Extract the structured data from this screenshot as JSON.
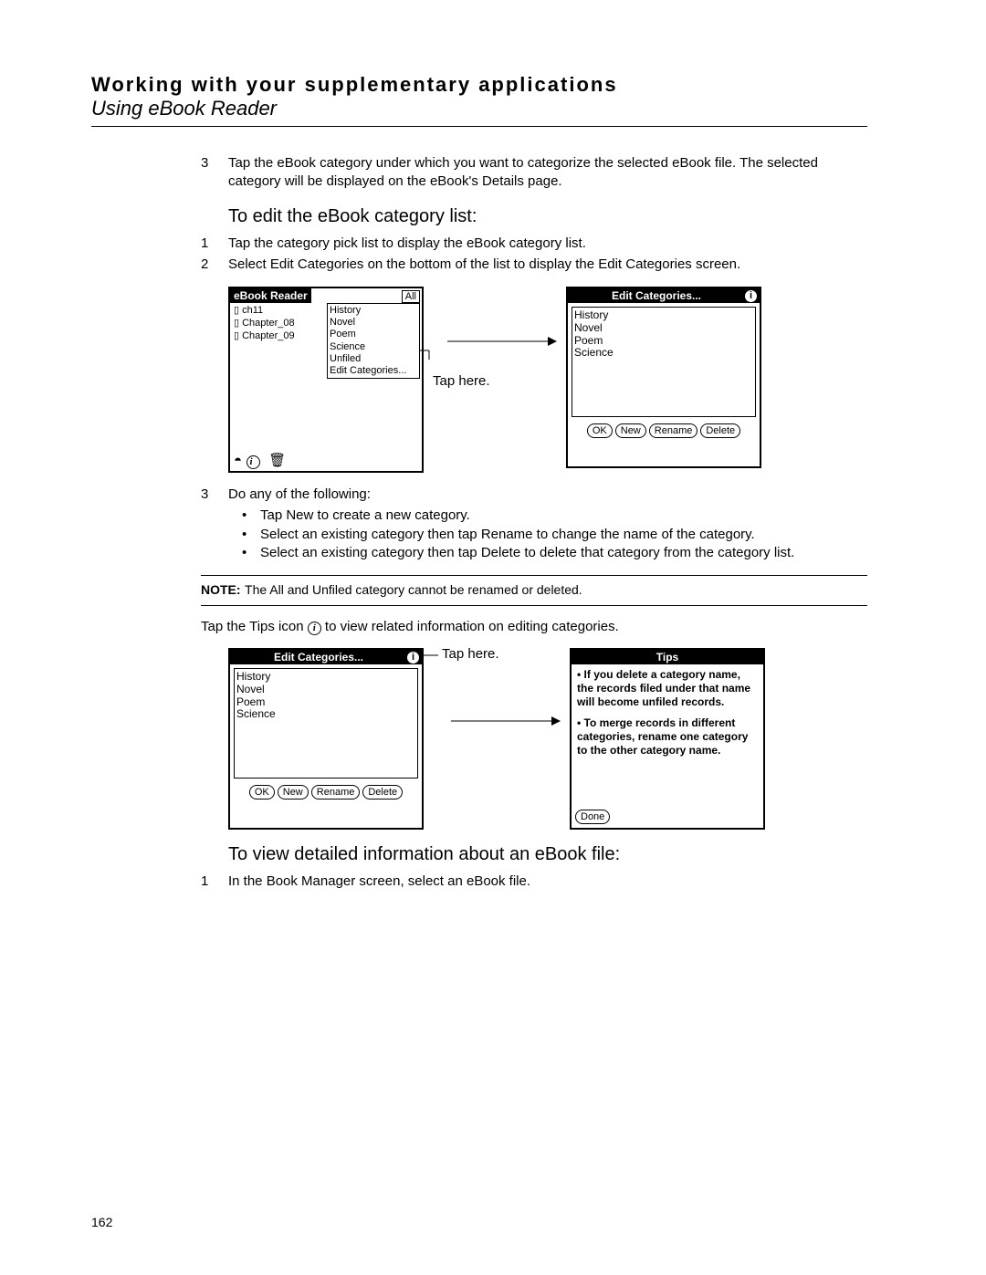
{
  "header": {
    "line1": "Working with your supplementary applications",
    "line2": "Using eBook Reader"
  },
  "page_number": "162",
  "step3_top": {
    "num": "3",
    "text": "Tap the eBook category under which you want to categorize the selected eBook file. The selected category will be displayed on the eBook's Details page."
  },
  "section1_title": "To edit the eBook category list:",
  "section1_steps": [
    {
      "num": "1",
      "text": "Tap the category pick list to display the eBook category list."
    },
    {
      "num": "2",
      "text": "Select Edit Categories on the bottom of the list to display the Edit Categories screen."
    }
  ],
  "figure1": {
    "reader_title": "eBook Reader",
    "dropdown_selected": "All",
    "files": [
      "ch11",
      "Chapter_08",
      "Chapter_09"
    ],
    "dropdown_items": [
      "History",
      "Novel",
      "Poem",
      "Science",
      "Unfiled",
      "Edit Categories..."
    ],
    "caption": "Tap here.",
    "right_title": "Edit Categories...",
    "right_list": [
      "History",
      "Novel",
      "Poem",
      "Science"
    ],
    "right_buttons": [
      "OK",
      "New",
      "Rename",
      "Delete"
    ]
  },
  "step3_mid": {
    "num": "3",
    "text": "Do any of the following:",
    "bullets": [
      "Tap New to create a new category.",
      "Select an existing category then tap Rename to change the name of the category.",
      "Select an existing category then tap Delete to delete that category from the category list."
    ]
  },
  "note": {
    "label": "NOTE:",
    "text": "The All and Unfiled category cannot be renamed or deleted."
  },
  "tips_line_before": "Tap the Tips icon ",
  "tips_line_after": " to view related information on editing categories.",
  "figure2": {
    "left_title": "Edit Categories...",
    "left_list": [
      "History",
      "Novel",
      "Poem",
      "Science"
    ],
    "left_buttons": [
      "OK",
      "New",
      "Rename",
      "Delete"
    ],
    "caption": "Tap here.",
    "right_title": "Tips",
    "tips_text1": "If you delete a category name, the records filed under that name will become unfiled records.",
    "tips_text2": "To merge records in different categories, rename one category to the other category name.",
    "right_button": "Done"
  },
  "section2_title": "To view detailed information about an eBook file:",
  "section2_step": {
    "num": "1",
    "text": "In the Book Manager screen, select an eBook file."
  }
}
